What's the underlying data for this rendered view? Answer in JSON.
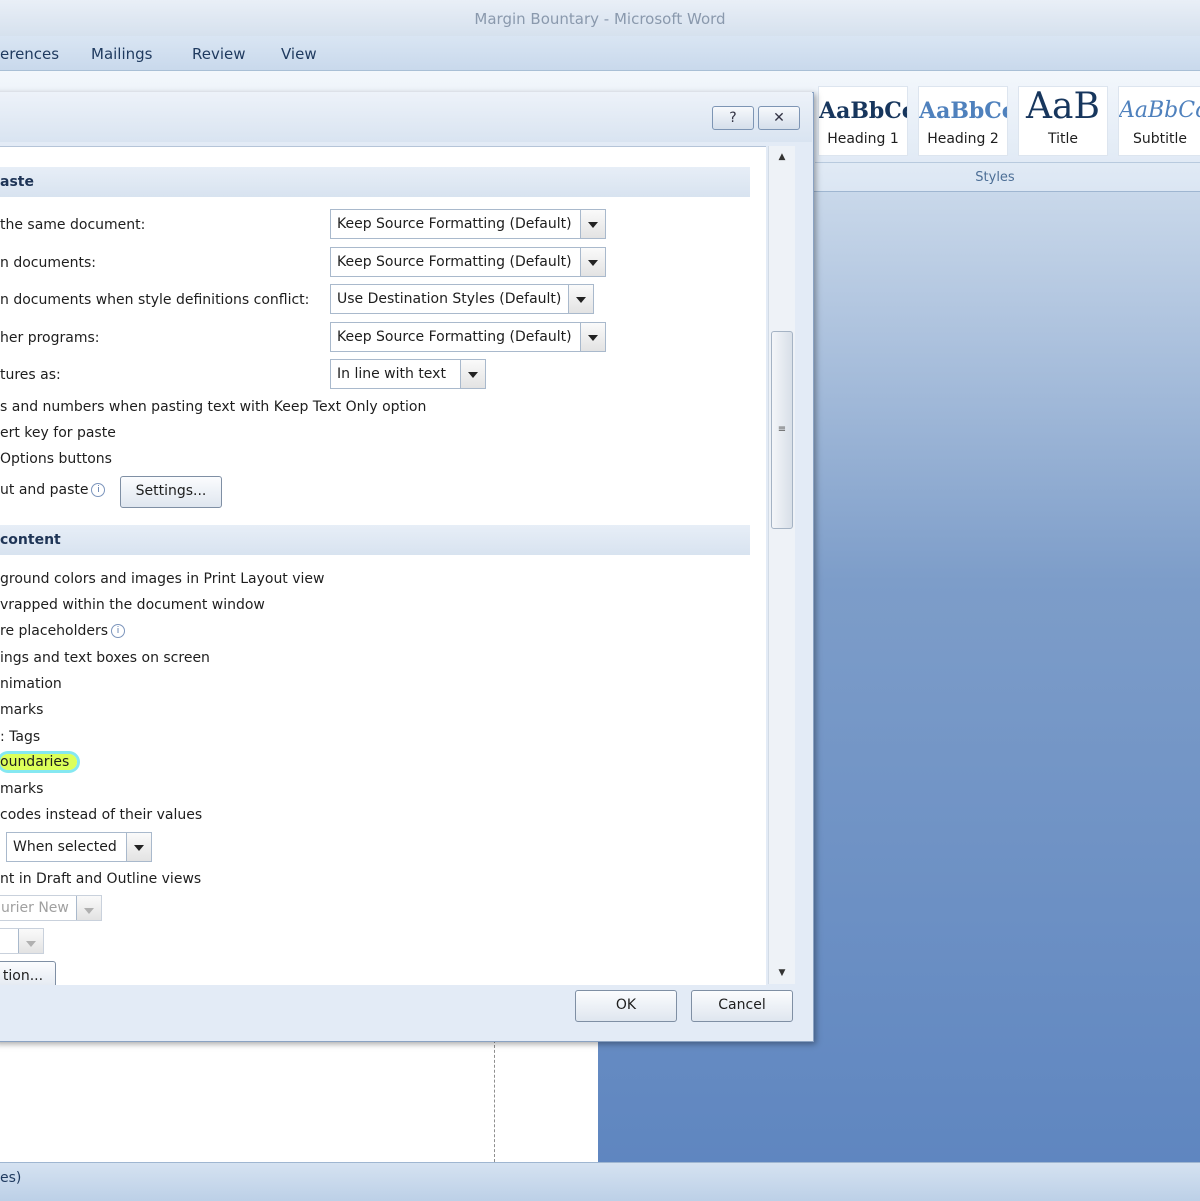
{
  "window": {
    "title": "Margin Bountary - Microsoft Word"
  },
  "ribbon": {
    "tabs": [
      "erences",
      "Mailings",
      "Review",
      "View"
    ],
    "styles": [
      {
        "preview": "AaBbCc",
        "name": "Heading 1"
      },
      {
        "preview": "AaBbCc",
        "name": "Heading 2"
      },
      {
        "preview": "AaB",
        "name": "Title"
      },
      {
        "preview": "AaBbCc",
        "name": "Subtitle"
      }
    ],
    "styles_group_label": "Styles"
  },
  "dialog": {
    "help_label": "?",
    "close_label": "✕",
    "sections": {
      "paste_title": "aste",
      "show_content_title": "content"
    },
    "paste_options": [
      {
        "label": "the same document:",
        "value": "Keep Source Formatting (Default)"
      },
      {
        "label": "n documents:",
        "value": "Keep Source Formatting (Default)"
      },
      {
        "label": "n documents when style definitions conflict:",
        "value": "Use Destination Styles (Default)"
      },
      {
        "label": "her programs:",
        "value": "Keep Source Formatting (Default)"
      },
      {
        "label": "tures as:",
        "value": "In line with text"
      }
    ],
    "paste_checks": [
      "s and numbers when pasting text with Keep Text Only option",
      "ert key for paste",
      " Options buttons"
    ],
    "cut_paste_label": "ut and paste",
    "settings_button": "Settings...",
    "show_options": [
      "ground colors and images in Print Layout view",
      "vrapped within the document window",
      "re placeholders",
      "ings and text boxes on screen",
      "nimation",
      "marks",
      ": Tags",
      "oundaries",
      "marks",
      "codes instead of their values"
    ],
    "field_shading_value": "When selected",
    "draft_font_label": "nt in Draft and Outline views",
    "font_name_value": "urier New",
    "font_size_value": "",
    "substitution_button": "tion...",
    "ok_button": "OK",
    "cancel_button": "Cancel",
    "highlight_color": "#d6ff3c"
  },
  "status": {
    "text": "es)"
  }
}
